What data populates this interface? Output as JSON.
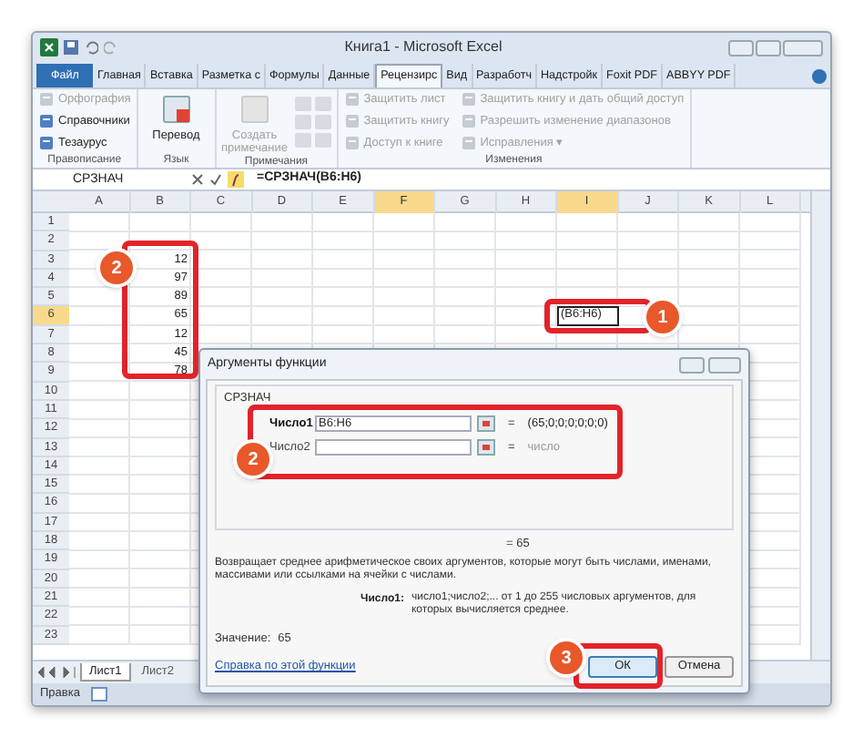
{
  "window": {
    "title": "Книга1 - Microsoft Excel"
  },
  "ribbon_tabs": [
    {
      "label": "Файл",
      "selected": false,
      "kind": "file"
    },
    {
      "label": "Главная",
      "selected": false,
      "kind": "tab"
    },
    {
      "label": "Вставка",
      "selected": false,
      "kind": "tab"
    },
    {
      "label": "Разметка с",
      "selected": false,
      "kind": "tab"
    },
    {
      "label": "Формулы",
      "selected": false,
      "kind": "tab"
    },
    {
      "label": "Данные",
      "selected": false,
      "kind": "tab"
    },
    {
      "label": "Рецензирс",
      "selected": true,
      "kind": "tab"
    },
    {
      "label": "Вид",
      "selected": false,
      "kind": "tab"
    },
    {
      "label": "Разработч",
      "selected": false,
      "kind": "tab"
    },
    {
      "label": "Надстройк",
      "selected": false,
      "kind": "tab"
    },
    {
      "label": "Foxit PDF",
      "selected": false,
      "kind": "tab"
    },
    {
      "label": "ABBYY PDF",
      "selected": false,
      "kind": "tab"
    }
  ],
  "ribbon_groups": [
    {
      "label": "Правописание",
      "items": [
        {
          "label": "Орфография",
          "kind": "small",
          "disabled": true
        },
        {
          "label": "Справочники",
          "kind": "small",
          "disabled": false
        },
        {
          "label": "Тезаурус",
          "kind": "small",
          "disabled": false
        }
      ]
    },
    {
      "label": "Язык",
      "items": [
        {
          "label": "Перевод",
          "kind": "large",
          "disabled": false
        }
      ]
    },
    {
      "label": "Примечания",
      "items": [
        {
          "label": "Создать примечание",
          "kind": "large",
          "disabled": true
        },
        {
          "kind": "icons",
          "disabled": true
        }
      ]
    },
    {
      "label": "Изменения",
      "items": [
        {
          "label": "Защитить лист",
          "kind": "small",
          "disabled": true
        },
        {
          "label": "Защитить книгу",
          "kind": "small",
          "disabled": true
        },
        {
          "label": "Доступ к книге",
          "kind": "small",
          "disabled": true
        },
        {
          "label": "Защитить книгу и дать общий доступ",
          "kind": "small",
          "disabled": true
        },
        {
          "label": "Разрешить изменение диапазонов",
          "kind": "small",
          "disabled": true
        },
        {
          "label": "Исправления ▾",
          "kind": "small",
          "disabled": true
        }
      ]
    }
  ],
  "formula_bar": {
    "name_box": "СРЗНАЧ",
    "formula": "=СРЗНАЧ(B6:H6)"
  },
  "columns": [
    {
      "label": "A",
      "selected": false
    },
    {
      "label": "B",
      "selected": false
    },
    {
      "label": "C",
      "selected": false
    },
    {
      "label": "D",
      "selected": false
    },
    {
      "label": "E",
      "selected": false
    },
    {
      "label": "F",
      "selected": true
    },
    {
      "label": "G",
      "selected": false
    },
    {
      "label": "H",
      "selected": false
    },
    {
      "label": "I",
      "selected": true
    },
    {
      "label": "J",
      "selected": false
    },
    {
      "label": "K",
      "selected": false
    },
    {
      "label": "L",
      "selected": false
    }
  ],
  "rows": [
    {
      "label": "1",
      "selected": false
    },
    {
      "label": "2",
      "selected": false
    },
    {
      "label": "3",
      "selected": false,
      "column_b": "12"
    },
    {
      "label": "4",
      "selected": false,
      "column_b": "97"
    },
    {
      "label": "5",
      "selected": false,
      "column_b": "89"
    },
    {
      "label": "6",
      "selected": true,
      "column_b": "65",
      "column_i": "(B6:H6)"
    },
    {
      "label": "7",
      "selected": false,
      "column_b": "12"
    },
    {
      "label": "8",
      "selected": false,
      "column_b": "45"
    },
    {
      "label": "9",
      "selected": false,
      "column_b": "78"
    },
    {
      "label": "10",
      "selected": false
    },
    {
      "label": "11",
      "selected": false
    },
    {
      "label": "12",
      "selected": false
    },
    {
      "label": "13",
      "selected": false
    },
    {
      "label": "14",
      "selected": false
    },
    {
      "label": "15",
      "selected": false
    },
    {
      "label": "16",
      "selected": false
    },
    {
      "label": "17",
      "selected": false
    },
    {
      "label": "18",
      "selected": false
    },
    {
      "label": "19",
      "selected": false
    },
    {
      "label": "20",
      "selected": false
    },
    {
      "label": "21",
      "selected": false
    },
    {
      "label": "22",
      "selected": false
    },
    {
      "label": "23",
      "selected": false
    }
  ],
  "sheet_tabs": [
    {
      "label": "Лист1",
      "selected": true
    },
    {
      "label": "Лист2",
      "selected": false
    }
  ],
  "status_bar": {
    "mode": "Правка"
  },
  "dialog": {
    "title": "Аргументы функции",
    "function": "СРЗНАЧ",
    "arguments": [
      {
        "label": "Число1",
        "bold": true,
        "value": "B6:H6",
        "sign": "=",
        "result": "(65;0;0;0;0;0;0)",
        "result_muted": false
      },
      {
        "label": "Число2",
        "bold": false,
        "sign": "=",
        "result": "число",
        "result_muted": true
      }
    ],
    "result": "= 65",
    "description": "Возвращает среднее арифметическое своих аргументов, которые могут быть числами, именами, массивами или ссылками на ячейки с числами.",
    "argument_help_label": "Число1:",
    "argument_help": "число1;число2;... от 1 до 255 числовых аргументов, для которых вычисляется среднее.",
    "value_label": "Значение:",
    "value": "65",
    "help_link": "Справка по этой функции",
    "buttons": [
      {
        "label": "ОК",
        "selected": true
      },
      {
        "label": "Отмена",
        "selected": false
      }
    ]
  },
  "annotations": [
    "1",
    "2",
    "2",
    "3"
  ]
}
